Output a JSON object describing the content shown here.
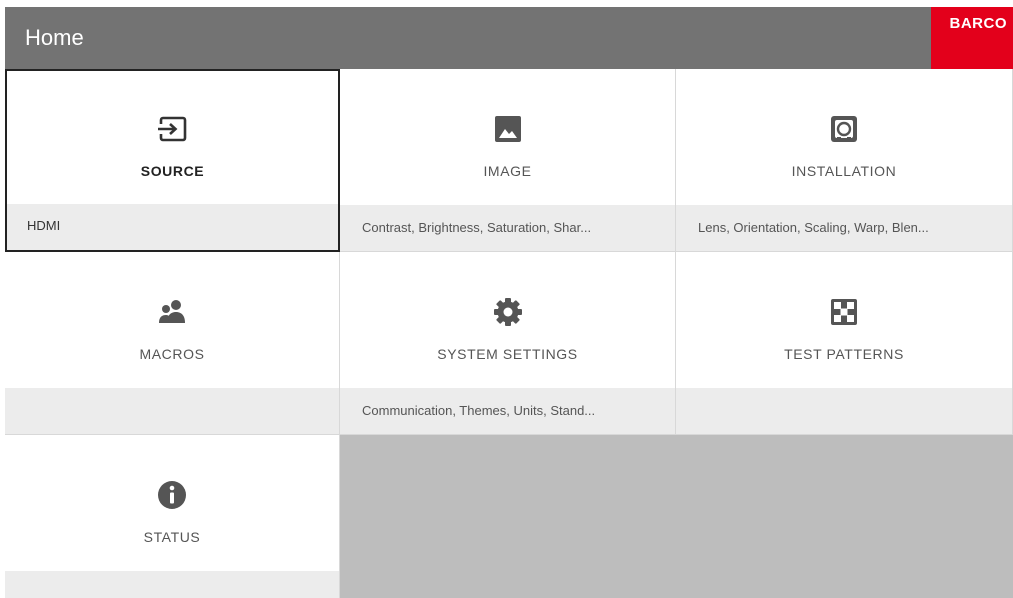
{
  "header": {
    "title": "Home",
    "logo_text": "BARCO",
    "logo_color": "#e3001b",
    "bar_color": "#737373"
  },
  "tiles": [
    {
      "label": "SOURCE",
      "detail": "HDMI",
      "icon": "source-input-icon",
      "selected": true
    },
    {
      "label": "IMAGE",
      "detail": "Contrast, Brightness, Saturation, Shar...",
      "icon": "image-icon",
      "selected": false
    },
    {
      "label": "INSTALLATION",
      "detail": "Lens, Orientation, Scaling, Warp, Blen...",
      "icon": "projector-lens-icon",
      "selected": false
    },
    {
      "label": "MACROS",
      "detail": "",
      "icon": "people-icon",
      "selected": false
    },
    {
      "label": "SYSTEM SETTINGS",
      "detail": "Communication, Themes, Units, Stand...",
      "icon": "gear-icon",
      "selected": false
    },
    {
      "label": "TEST PATTERNS",
      "detail": "",
      "icon": "checkerboard-icon",
      "selected": false
    },
    {
      "label": "STATUS",
      "detail": "",
      "icon": "info-icon",
      "selected": false
    }
  ]
}
